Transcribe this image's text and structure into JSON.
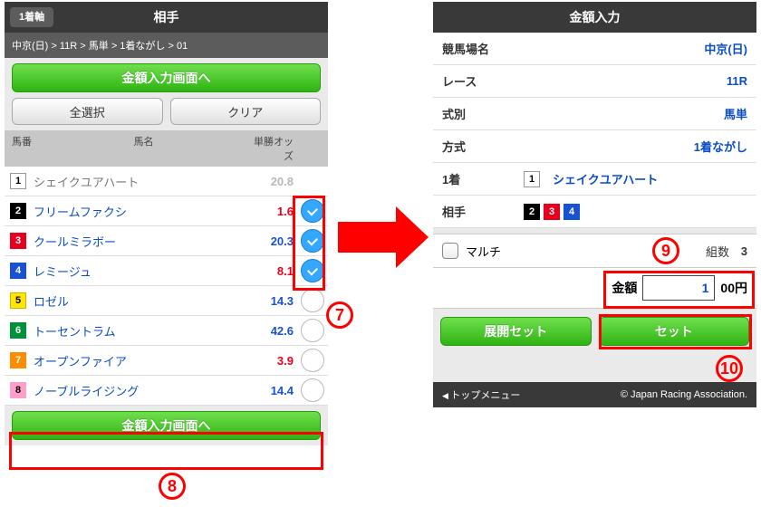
{
  "left": {
    "back_label": "1着軸",
    "title": "相手",
    "breadcrumb": "中京(日) > 11R > 馬単 > 1着ながし > 01",
    "go_amount_label": "金額入力画面へ",
    "select_all_label": "全選択",
    "clear_label": "クリア",
    "colhead": {
      "num": "馬番",
      "name": "馬名",
      "odds": "単勝オッズ"
    },
    "horses": [
      {
        "num": "1",
        "cls": "",
        "name": "シェイクユアハート",
        "odds": "20.8",
        "odds_color": "g",
        "axis": true,
        "checked": false
      },
      {
        "num": "2",
        "cls": "n2",
        "name": "フリームファクシ",
        "odds": "1.6",
        "odds_color": "r",
        "axis": false,
        "checked": true
      },
      {
        "num": "3",
        "cls": "n3",
        "name": "クールミラボー",
        "odds": "20.3",
        "odds_color": "b",
        "axis": false,
        "checked": true
      },
      {
        "num": "4",
        "cls": "n4",
        "name": "レミージュ",
        "odds": "8.1",
        "odds_color": "r",
        "axis": false,
        "checked": true
      },
      {
        "num": "5",
        "cls": "n5",
        "name": "ロゼル",
        "odds": "14.3",
        "odds_color": "b",
        "axis": false,
        "checked": false
      },
      {
        "num": "6",
        "cls": "n6",
        "name": "トーセントラム",
        "odds": "42.6",
        "odds_color": "b",
        "axis": false,
        "checked": false
      },
      {
        "num": "7",
        "cls": "n7",
        "name": "オープンファイア",
        "odds": "3.9",
        "odds_color": "r",
        "axis": false,
        "checked": false
      },
      {
        "num": "8",
        "cls": "n8",
        "name": "ノーブルライジング",
        "odds": "14.4",
        "odds_color": "b",
        "axis": false,
        "checked": false
      }
    ]
  },
  "right": {
    "title": "金額入力",
    "rows": {
      "track_lbl": "競馬場名",
      "track_val": "中京(日)",
      "race_lbl": "レース",
      "race_val": "11R",
      "type_lbl": "式別",
      "type_val": "馬単",
      "method_lbl": "方式",
      "method_val": "1着ながし",
      "axis_lbl": "1着",
      "axis_num": "1",
      "axis_name": "シェイクユアハート",
      "opp_lbl": "相手",
      "opp_chips": [
        "2",
        "3",
        "4"
      ]
    },
    "multi_label": "マルチ",
    "combo_label": "組数",
    "combo_value": "3",
    "amount_label": "金額",
    "amount_value": "1",
    "amount_unit": "00円",
    "btn_expand": "展開セット",
    "btn_set": "セット",
    "footer_left": "トップメニュー",
    "footer_right": "© Japan Racing Association."
  },
  "annotations": {
    "n7": "7",
    "n8": "8",
    "n9": "9",
    "n10": "10"
  }
}
